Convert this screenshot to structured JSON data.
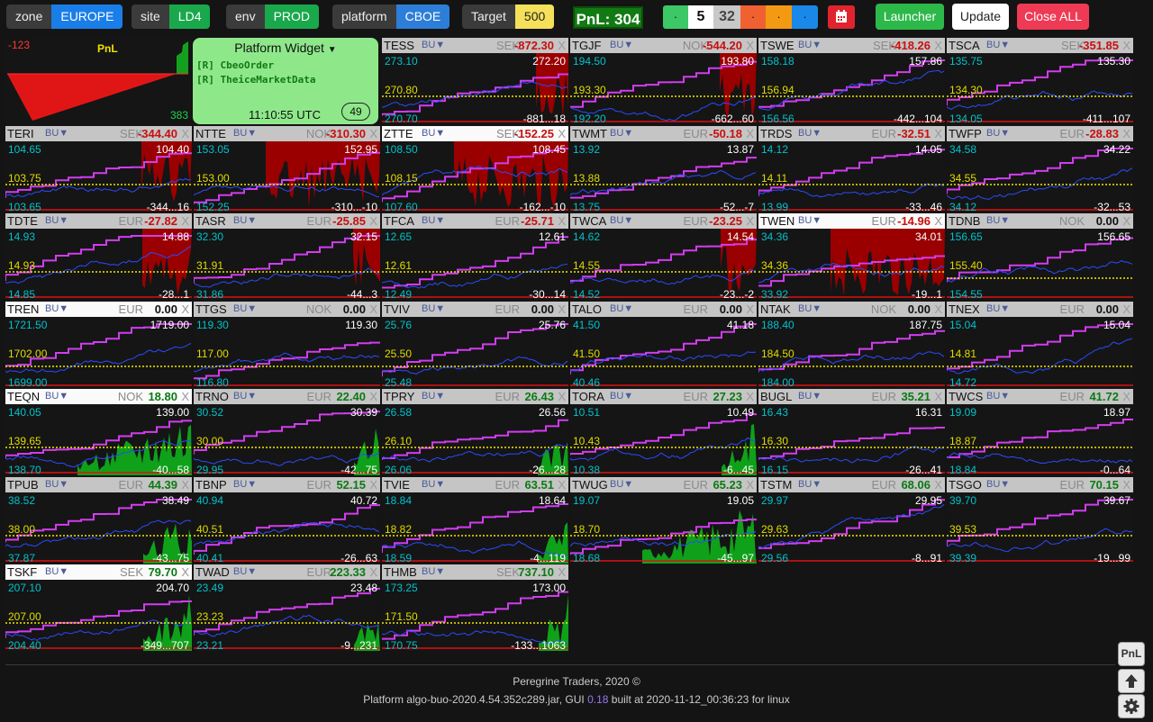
{
  "topbar": {
    "chips": [
      {
        "name": "zone",
        "key": "zone",
        "value": "EUROPE",
        "color": "#1a7ee8"
      },
      {
        "name": "site",
        "key": "site",
        "value": "LD4",
        "color": "#1aa84c"
      },
      {
        "name": "env",
        "key": "env",
        "value": "PROD",
        "color": "#1aa84c"
      },
      {
        "name": "platform",
        "key": "platform",
        "value": "CBOE",
        "color": "#2d7ed8"
      }
    ],
    "target_label": "Target",
    "target_value": "500",
    "pnl_total": "PnL: 304",
    "counters": [
      "·",
      "5",
      "32",
      "·",
      "·",
      "·"
    ],
    "counter_colors": [
      "#3cc866",
      "#ffffff",
      "#c8c8c8",
      "#f06030",
      "#f39a12",
      "#1a88e8"
    ],
    "calendar_icon": "calendar-icon",
    "launcher_label": "Launcher",
    "update_label": "Update",
    "close_all_label": "Close ALL"
  },
  "pnl_tile": {
    "title": "PnL",
    "top_value": "-123",
    "bottom_value": "383"
  },
  "widget": {
    "title": "Platform Widget",
    "items": [
      "[R] CbeoOrder",
      "[R] TheiceMarketData"
    ],
    "time": "11:10:55 UTC",
    "badge": "49"
  },
  "tiles": [
    {
      "sym": "TESS",
      "cur": "SEK",
      "pnl": "-872.30",
      "y1": "273.10",
      "y2": "270.80",
      "y3": "270.70",
      "r1": "272.20",
      "r3": "-881...18",
      "kind": "red-right"
    },
    {
      "sym": "TGJF",
      "cur": "NOK",
      "pnl": "-544.20",
      "y1": "194.50",
      "y2": "193.30",
      "y3": "192.20",
      "r1": "193.80",
      "r3": "-662...60",
      "kind": "red-right"
    },
    {
      "sym": "TSWE",
      "cur": "SEK",
      "pnl": "-418.26",
      "y1": "158.18",
      "y2": "156.94",
      "y3": "156.56",
      "r1": "157.86",
      "r3": "-442...104",
      "kind": "red-lines"
    },
    {
      "sym": "TSCA",
      "cur": "SEK",
      "pnl": "-351.85",
      "y1": "135.75",
      "y2": "134.30",
      "y3": "134.05",
      "r1": "135.30",
      "r3": "-411...107",
      "kind": "red-lines"
    },
    {
      "sym": "TERI",
      "cur": "SEK",
      "pnl": "-344.40",
      "y1": "104.65",
      "y2": "103.75",
      "y3": "103.65",
      "r1": "104.40",
      "r3": "-344...16",
      "kind": "red-right"
    },
    {
      "sym": "NTTE",
      "cur": "NOK",
      "pnl": "-310.30",
      "y1": "153.05",
      "y2": "153.00",
      "y3": "152.25",
      "r1": "152.95",
      "r3": "-310...-10",
      "kind": "red-half"
    },
    {
      "sym": "ZTTE",
      "cur": "SEK",
      "pnl": "-152.25",
      "y1": "108.50",
      "y2": "108.15",
      "y3": "107.60",
      "r1": "108.45",
      "r3": "-162...-10",
      "kind": "red-half",
      "sel": true
    },
    {
      "sym": "TWMT",
      "cur": "EUR",
      "pnl": "-50.18",
      "y1": "13.92",
      "y2": "13.88",
      "y3": "13.75",
      "r1": "13.87",
      "r3": "-52...-7",
      "kind": "red-lines"
    },
    {
      "sym": "TRDS",
      "cur": "EUR",
      "pnl": "-32.51",
      "y1": "14.12",
      "y2": "14.11",
      "y3": "13.99",
      "r1": "14.05",
      "r3": "-33...46",
      "kind": "red-lines"
    },
    {
      "sym": "TWFP",
      "cur": "EUR",
      "pnl": "-28.83",
      "y1": "34.58",
      "y2": "34.55",
      "y3": "34.12",
      "r1": "34.22",
      "r3": "-32...53",
      "kind": "red-lines"
    },
    {
      "sym": "TDTE",
      "cur": "EUR",
      "pnl": "-27.82",
      "y1": "14.93",
      "y2": "14.93",
      "y3": "14.85",
      "r1": "14.88",
      "r3": "-28...1",
      "kind": "red-right"
    },
    {
      "sym": "TASR",
      "cur": "EUR",
      "pnl": "-25.85",
      "y1": "32.30",
      "y2": "31.91",
      "y3": "31.86",
      "r1": "32.15",
      "r3": "-44...3",
      "kind": "red-right"
    },
    {
      "sym": "TFCA",
      "cur": "EUR",
      "pnl": "-25.71",
      "y1": "12.65",
      "y2": "12.61",
      "y3": "12.49",
      "r1": "12.61",
      "r3": "-30...14",
      "kind": "red-lines"
    },
    {
      "sym": "TWCA",
      "cur": "EUR",
      "pnl": "-23.25",
      "y1": "14.62",
      "y2": "14.55",
      "y3": "14.52",
      "r1": "14.54",
      "r3": "-23...-2",
      "kind": "red-right"
    },
    {
      "sym": "TWEN",
      "cur": "EUR",
      "pnl": "-14.96",
      "y1": "34.36",
      "y2": "34.36",
      "y3": "33.92",
      "r1": "34.01",
      "r3": "-19...1",
      "kind": "red-half",
      "sel": true
    },
    {
      "sym": "TDNB",
      "cur": "NOK",
      "pnl": "0.00",
      "y1": "156.65",
      "y2": "155.40",
      "y3": "154.55",
      "r1": "156.65",
      "r3": "",
      "kind": "flat"
    },
    {
      "sym": "TREN",
      "cur": "EUR",
      "pnl": "0.00",
      "y1": "1721.50",
      "y2": "1702.00",
      "y3": "1699.00",
      "r1": "1719.00",
      "r3": "",
      "kind": "flat",
      "sel": true
    },
    {
      "sym": "TTGS",
      "cur": "NOK",
      "pnl": "0.00",
      "y1": "119.30",
      "y2": "117.00",
      "y3": "116.80",
      "r1": "119.30",
      "r3": "",
      "kind": "flat"
    },
    {
      "sym": "TVIV",
      "cur": "EUR",
      "pnl": "0.00",
      "y1": "25.76",
      "y2": "25.50",
      "y3": "25.48",
      "r1": "25.76",
      "r3": "",
      "kind": "flat"
    },
    {
      "sym": "TALO",
      "cur": "EUR",
      "pnl": "0.00",
      "y1": "41.50",
      "y2": "41.50",
      "y3": "40.46",
      "r1": "41.18",
      "r3": "",
      "kind": "flat"
    },
    {
      "sym": "NTAK",
      "cur": "NOK",
      "pnl": "0.00",
      "y1": "188.40",
      "y2": "184.50",
      "y3": "184.00",
      "r1": "187.75",
      "r3": "",
      "kind": "flat"
    },
    {
      "sym": "TNEX",
      "cur": "EUR",
      "pnl": "0.00",
      "y1": "15.04",
      "y2": "14.81",
      "y3": "14.72",
      "r1": "15.04",
      "r3": "",
      "kind": "flat"
    },
    {
      "sym": "TEQN",
      "cur": "NOK",
      "pnl": "18.80",
      "y1": "140.05",
      "y2": "139.65",
      "y3": "138.70",
      "r1": "139.00",
      "r3": "-40...58",
      "kind": "green-half",
      "sel": true
    },
    {
      "sym": "TRNO",
      "cur": "EUR",
      "pnl": "22.40",
      "y1": "30.52",
      "y2": "30.00",
      "y3": "29.95",
      "r1": "30.39",
      "r3": "-42...75",
      "kind": "green-right"
    },
    {
      "sym": "TPRY",
      "cur": "EUR",
      "pnl": "26.43",
      "y1": "26.58",
      "y2": "26.10",
      "y3": "26.06",
      "r1": "26.56",
      "r3": "-26...28",
      "kind": "green-right"
    },
    {
      "sym": "TORA",
      "cur": "EUR",
      "pnl": "27.23",
      "y1": "10.51",
      "y2": "10.43",
      "y3": "10.38",
      "r1": "10.49",
      "r3": "-6...45",
      "kind": "green-right"
    },
    {
      "sym": "BUGL",
      "cur": "EUR",
      "pnl": "35.21",
      "y1": "16.43",
      "y2": "16.30",
      "y3": "16.15",
      "r1": "16.31",
      "r3": "-26...41",
      "kind": "green-lines"
    },
    {
      "sym": "TWCS",
      "cur": "EUR",
      "pnl": "41.72",
      "y1": "19.09",
      "y2": "18.87",
      "y3": "18.84",
      "r1": "18.97",
      "r3": "-0...64",
      "kind": "green-lines"
    },
    {
      "sym": "TPUB",
      "cur": "EUR",
      "pnl": "44.39",
      "y1": "38.52",
      "y2": "38.00",
      "y3": "37.87",
      "r1": "38.49",
      "r3": "-43...75",
      "kind": "green-right"
    },
    {
      "sym": "TBNP",
      "cur": "EUR",
      "pnl": "52.15",
      "y1": "40.94",
      "y2": "40.51",
      "y3": "40.41",
      "r1": "40.72",
      "r3": "-26...63",
      "kind": "green-lines"
    },
    {
      "sym": "TVIE",
      "cur": "EUR",
      "pnl": "63.51",
      "y1": "18.84",
      "y2": "18.82",
      "y3": "18.59",
      "r1": "18.64",
      "r3": "-4...119",
      "kind": "green-right"
    },
    {
      "sym": "TWUG",
      "cur": "EUR",
      "pnl": "65.23",
      "y1": "19.07",
      "y2": "18.70",
      "y3": "18.68",
      "r1": "19.05",
      "r3": "-45...97",
      "kind": "green-half"
    },
    {
      "sym": "TSTM",
      "cur": "EUR",
      "pnl": "68.06",
      "y1": "29.97",
      "y2": "29.63",
      "y3": "29.56",
      "r1": "29.95",
      "r3": "-8...91",
      "kind": "green-lines"
    },
    {
      "sym": "TSGO",
      "cur": "EUR",
      "pnl": "70.15",
      "y1": "39.70",
      "y2": "39.53",
      "y3": "39.39",
      "r1": "39.67",
      "r3": "-19...99",
      "kind": "green-lines"
    },
    {
      "sym": "TSKF",
      "cur": "SEK",
      "pnl": "79.70",
      "y1": "207.10",
      "y2": "207.00",
      "y3": "204.40",
      "r1": "204.70",
      "r3": "-349...707",
      "kind": "green-right",
      "sel": true
    },
    {
      "sym": "TWAD",
      "cur": "EUR",
      "pnl": "223.33",
      "y1": "23.49",
      "y2": "23.23",
      "y3": "23.21",
      "r1": "23.48",
      "r3": "-9...231",
      "kind": "green-right"
    },
    {
      "sym": "THMB",
      "cur": "SEK",
      "pnl": "737.10",
      "y1": "173.25",
      "y2": "171.50",
      "y3": "170.75",
      "r1": "173.00",
      "r3": "-133...1063",
      "kind": "green-right"
    }
  ],
  "bu_label": "BU",
  "close_glyph": "X",
  "footer": {
    "company": "Peregrine Traders, 2020 ©",
    "build_prefix": "Platform algo-buo-2020.4.54.352c289.jar, GUI ",
    "gui_version": "0.18",
    "build_suffix": " built at 2020-11-12_00:36:23 for linux"
  },
  "side_buttons": {
    "pnl": "PnL",
    "up_icon": "arrow-up-icon",
    "settings_icon": "gear-icon"
  }
}
